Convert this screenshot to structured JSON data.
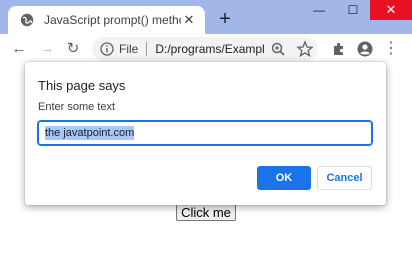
{
  "browser": {
    "tab_title": "JavaScript prompt() method",
    "tab_close": "✕",
    "new_tab": "+",
    "minimize": "—",
    "maximize": "☐",
    "close": "✕",
    "back_icon": "←",
    "forward_icon": "→",
    "reload_icon": "↻",
    "menu_icon": "⋮"
  },
  "omnibox": {
    "scheme_label": "File",
    "url": "D:/programs/Exampl..."
  },
  "page": {
    "button_label": "Click me"
  },
  "dialog": {
    "title": "This page says",
    "message": "Enter some text",
    "input_value": "the javatpoint.com",
    "ok_label": "OK",
    "cancel_label": "Cancel"
  },
  "colors": {
    "frame": "#a3b6e8",
    "accent": "#1a73e8",
    "close_red": "#e81123",
    "selection": "#a8c7fa"
  }
}
